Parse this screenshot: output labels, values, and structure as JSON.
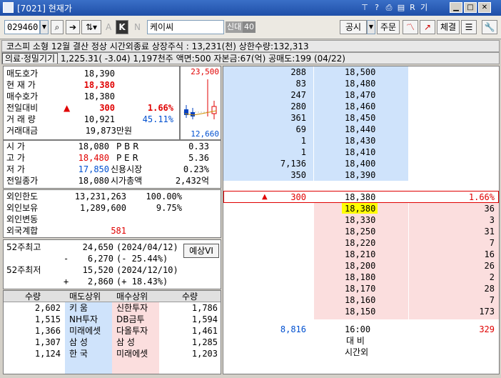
{
  "window": {
    "title_code": "[7021]",
    "title_name": "현재가",
    "tb_icons": [
      "?",
      "R",
      "기"
    ]
  },
  "toolbar": {
    "stock_code": "029460",
    "stock_name": "케이씨",
    "tag1": "신대",
    "tag2": "40",
    "btn_a": "A",
    "btn_k": "K",
    "btn_n": "N",
    "btn_notice": "공시",
    "btn_order": "주문",
    "btn_trade": "체결"
  },
  "info": {
    "line1": "코스피 소형 12월 결산 정상   시간외종료  상장주식 : 13,231(천) 상한수량:132,313",
    "sector": "의료·정밀기기",
    "line2": " 1,225.31(  -3.04) 1,197천주 액면:500 자본금:67(억) 공매도:199 (04/22)"
  },
  "price": {
    "ask_label": "매도호가",
    "ask": "18,390",
    "cur_label": "현 재 가",
    "cur": "18,380",
    "bid_label": "매수호가",
    "bid": "18,380",
    "chg_label": "전일대비",
    "chg_arrow": "▲",
    "chg": "300",
    "chg_pct": "1.66%",
    "vol_label": "거 래 량",
    "vol": "10,921",
    "vol_pct": "45.11%",
    "amt_label": "거래대금",
    "amt": "19,873만원",
    "chart_high": "23,500",
    "chart_low": "12,660"
  },
  "ohlc": [
    {
      "l": "시    가",
      "v": "18,080",
      "k": "P B R",
      "kv": "0.33"
    },
    {
      "l": "고    가",
      "v": "18,480",
      "k": "P E R",
      "kv": "5.36"
    },
    {
      "l": "저    가",
      "v": "17,850",
      "k": "신용시장",
      "kv": "0.23%"
    },
    {
      "l": "전일종가",
      "v": "18,080",
      "k": "시가총액",
      "kv": "2,432억"
    }
  ],
  "foreign": [
    {
      "l": "외인한도",
      "v": "13,231,263",
      "p": "100.00%"
    },
    {
      "l": "외인보유",
      "v": "1,289,600",
      "p": "9.75%"
    },
    {
      "l": "외인변동",
      "v": "",
      "p": ""
    },
    {
      "l": "외국계합",
      "v": "581",
      "p": ""
    }
  ],
  "w52": {
    "high_label": "52주최고",
    "high": "24,650",
    "high_date": "(2024/04/12)",
    "high_sign": "-",
    "high_diff": "6,270",
    "high_pct": "(-  25.44%)",
    "low_label": "52주최저",
    "low": "15,520",
    "low_date": "(2024/12/10)",
    "low_sign": "+",
    "low_diff": "2,860",
    "low_pct": "(+  18.43%)",
    "btn": "예상VI"
  },
  "brokers": {
    "h_qty": "수량",
    "h_sell": "매도상위",
    "h_buy": "매수상위",
    "h_qty2": "수량",
    "rows": [
      {
        "sq": "2,602",
        "s": "키    움",
        "b": "신한투자",
        "bq": "1,786"
      },
      {
        "sq": "1,515",
        "s": "NH투자",
        "b": "DB금투",
        "bq": "1,594"
      },
      {
        "sq": "1,366",
        "s": "미래에셋",
        "b": "다올투자",
        "bq": "1,461"
      },
      {
        "sq": "1,307",
        "s": "삼    성",
        "b": "삼    성",
        "bq": "1,285"
      },
      {
        "sq": "1,124",
        "s": "한    국",
        "b": "미래에셋",
        "bq": "1,203"
      }
    ]
  },
  "book": {
    "asks": [
      {
        "q": "288",
        "p": "18,500"
      },
      {
        "q": "83",
        "p": "18,480"
      },
      {
        "q": "247",
        "p": "18,470"
      },
      {
        "q": "280",
        "p": "18,460"
      },
      {
        "q": "361",
        "p": "18,450"
      },
      {
        "q": "69",
        "p": "18,440"
      },
      {
        "q": "1",
        "p": "18,430"
      },
      {
        "q": "1",
        "p": "18,410"
      },
      {
        "q": "7,136",
        "p": "18,400"
      },
      {
        "q": "350",
        "p": "18,390"
      }
    ],
    "cur": {
      "arrow": "▲",
      "chg": "300",
      "p": "18,380",
      "pct": "1.66%"
    },
    "bids": [
      {
        "p": "18,380",
        "q": "36"
      },
      {
        "p": "18,330",
        "q": "3"
      },
      {
        "p": "18,250",
        "q": "31"
      },
      {
        "p": "18,220",
        "q": "7"
      },
      {
        "p": "18,210",
        "q": "16"
      },
      {
        "p": "18,200",
        "q": "26"
      },
      {
        "p": "18,180",
        "q": "2"
      },
      {
        "p": "18,170",
        "q": "28"
      },
      {
        "p": "18,160",
        "q": "7"
      },
      {
        "p": "18,150",
        "q": "173"
      }
    ],
    "tot_ask": "8,816",
    "time": "16:00",
    "tot_bid": "329",
    "label1": "대  비",
    "label2": "시간외"
  }
}
